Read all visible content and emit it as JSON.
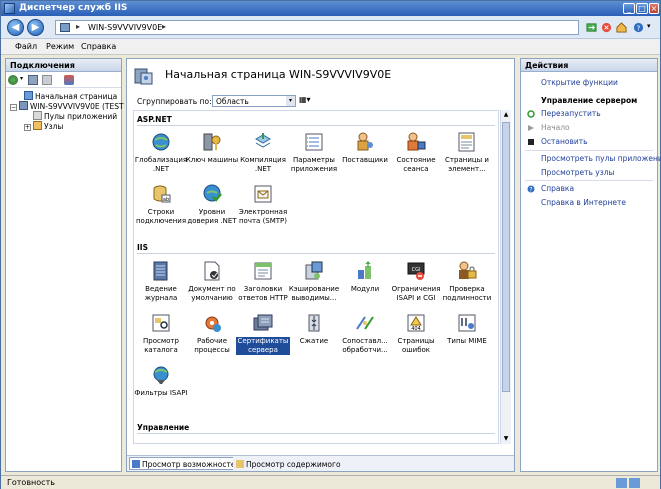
{
  "window": {
    "title": "Диспетчер служб IIS"
  },
  "address": {
    "crumb": "WIN-S9VVVIV9V0E"
  },
  "menu": {
    "items": [
      "Файл",
      "Режим",
      "Справка"
    ]
  },
  "connections": {
    "header": "Подключения",
    "tree": {
      "start_page": "Начальная страница",
      "server": "WIN-S9VVVIV9V0E (TEST",
      "app_pools": "Пулы приложений",
      "sites": "Узлы"
    }
  },
  "center": {
    "title": "Начальная страница WIN-S9VVVIV9V0E",
    "group_label": "Сгруппировать по:",
    "group_value": "Область",
    "sections": {
      "aspnet": "ASP.NET",
      "iis": "IIS",
      "management": "Управление"
    },
    "aspnet_features": [
      "Глобализация .NET",
      "Ключ машины",
      "Компиляция .NET",
      "Параметры приложения",
      "Поставщики",
      "Состояние сеанса",
      "Страницы и элемент...",
      "Строки подключения",
      "Уровни доверия .NET",
      "Электронная почта (SMTP)"
    ],
    "iis_features": [
      "Ведение журнала",
      "Документ по умолчанию",
      "Заголовки ответов HTTP",
      "Кэширование выводимы...",
      "Модули",
      "Ограничения ISAPI и CGI",
      "Проверка подлинности",
      "Просмотр каталога",
      "Рабочие процессы",
      "Сертификаты сервера",
      "Сжатие",
      "Сопоставл... обработчи...",
      "Страницы ошибок",
      "Типы MIME",
      "Фильтры ISAPI"
    ],
    "view_tabs": [
      "Просмотр возможностей",
      "Просмотр содержимого"
    ]
  },
  "actions": {
    "header": "Действия",
    "open_feature": "Открытие функции",
    "manage_header": "Управление сервером",
    "restart": "Перезапустить",
    "start": "Начало",
    "stop": "Остановить",
    "view_pools": "Просмотреть пулы приложений",
    "view_sites": "Просмотреть узлы",
    "help": "Справка",
    "online_help": "Справка в Интернете"
  },
  "status": {
    "text": "Готовность"
  },
  "colors": {
    "accent": "#1f4d99",
    "link": "#1f3f9a",
    "titlebar": "#2a5fb8"
  }
}
